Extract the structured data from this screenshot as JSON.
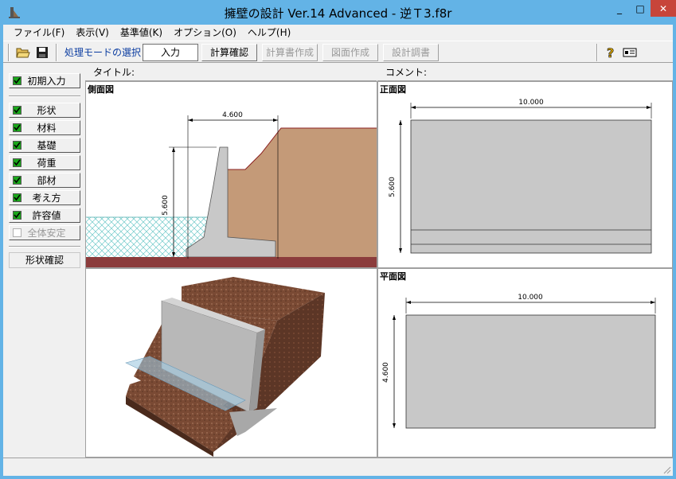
{
  "window": {
    "title": "擁壁の設計 Ver.14 Advanced  - 逆Ｔ3.f8r",
    "minimize": "_",
    "maximize": "□",
    "close": "✕"
  },
  "menu": [
    {
      "label": "ファイル(F)"
    },
    {
      "label": "表示(V)"
    },
    {
      "label": "基準値(K)"
    },
    {
      "label": "オプション(O)"
    },
    {
      "label": "ヘルプ(H)"
    }
  ],
  "toolbar": {
    "open_icon": "folder-open-icon",
    "save_icon": "save-icon",
    "mode_label": "処理モードの選択",
    "mode_buttons": [
      {
        "label": "入力"
      },
      {
        "label": "計算確認"
      },
      {
        "label": "計算書作成"
      },
      {
        "label": "図面作成"
      },
      {
        "label": "設計調書"
      }
    ],
    "help_icon": "help-icon",
    "other_icon": "card-icon"
  },
  "sidebar": {
    "initial": "初期入力",
    "items": [
      {
        "label": "形状"
      },
      {
        "label": "材料"
      },
      {
        "label": "基礎"
      },
      {
        "label": "荷重"
      },
      {
        "label": "部材"
      },
      {
        "label": "考え方"
      },
      {
        "label": "許容値"
      },
      {
        "label": "全体安定"
      }
    ],
    "shape_check": "形状確認"
  },
  "headers": {
    "title_label": "タイトル:",
    "comment_label": "コメント:"
  },
  "panes": {
    "side_view": {
      "title": "側面図",
      "width_dim": "4.600",
      "height_dim": "5.600"
    },
    "front_view": {
      "title": "正面図",
      "width_dim": "10.000",
      "height_dim": "5.600"
    },
    "plan_view": {
      "title": "平面図",
      "width_dim": "10.000",
      "height_dim": "4.600"
    }
  },
  "colors": {
    "title_bar": "#63b3e6",
    "soil": "#c49a78",
    "base_soil": "#8b3c3c",
    "concrete": "#c8c8c8",
    "check_green": "#1aa61a",
    "mode_label": "#0a3ca0"
  }
}
